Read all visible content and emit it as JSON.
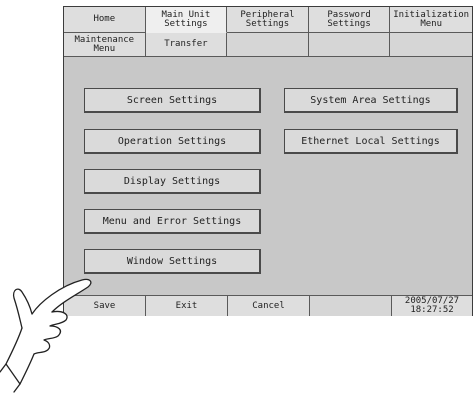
{
  "tabs_row1": [
    {
      "label": "Home",
      "active": false
    },
    {
      "label": "Main Unit\nSettings",
      "active": true
    },
    {
      "label": "Peripheral\nSettings",
      "active": false
    },
    {
      "label": "Password\nSettings",
      "active": false
    },
    {
      "label": "Initialization\nMenu",
      "active": false
    }
  ],
  "tabs_row2": [
    {
      "label": "Maintenance\nMenu"
    },
    {
      "label": "Transfer"
    },
    {
      "label": ""
    },
    {
      "label": ""
    },
    {
      "label": ""
    }
  ],
  "buttons": {
    "screen_settings": "Screen Settings",
    "operation_settings": "Operation Settings",
    "display_settings": "Display Settings",
    "menu_error_settings": "Menu and Error Settings",
    "window_settings": "Window Settings",
    "system_area_settings": "System Area Settings",
    "ethernet_local_settings": "Ethernet Local Settings"
  },
  "bottom_bar": {
    "save": "Save",
    "exit": "Exit",
    "cancel": "Cancel",
    "blank": "",
    "datetime": "2005/07/27\n18:27:52"
  },
  "icons": {
    "pointing_hand": "pointing-hand-icon"
  }
}
